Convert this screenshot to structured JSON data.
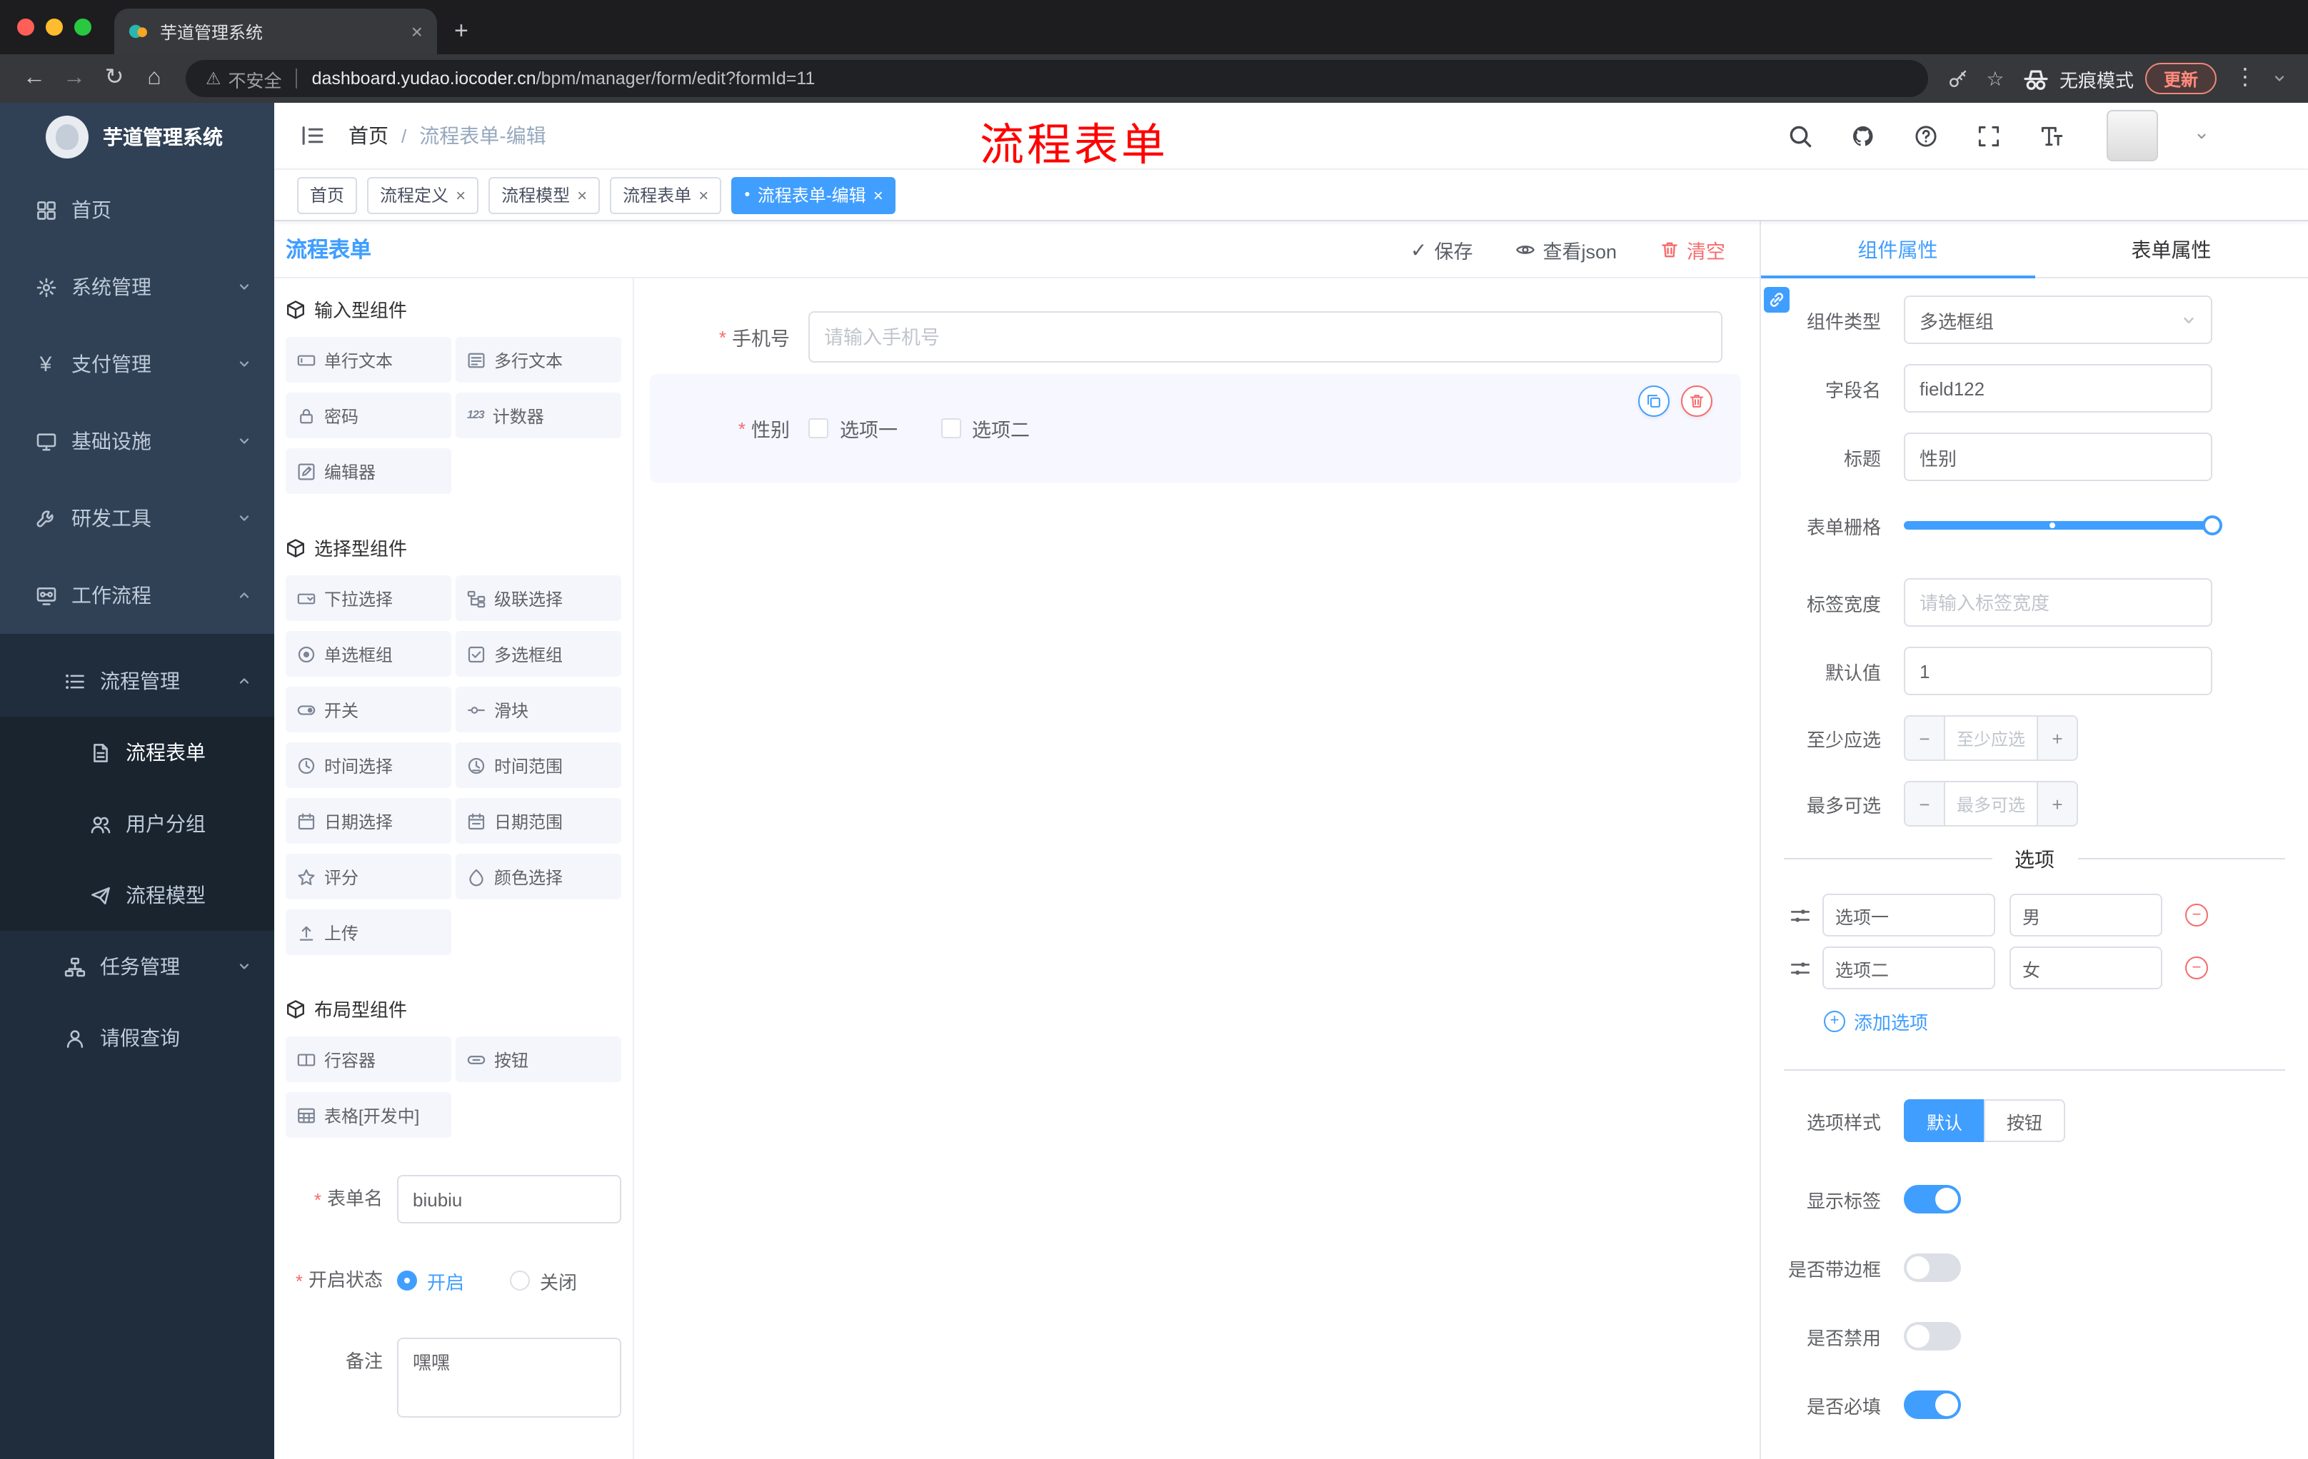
{
  "colors": {
    "accent": "#409eff",
    "danger": "#f56c6c",
    "sidebar_bg": "#304156",
    "annotation": "#ff0000"
  },
  "icons": {
    "favicon": "svg:favicon",
    "close": "×",
    "new-tab": "+",
    "back": "←",
    "forward": "→",
    "reload": "↻",
    "home": "⌂",
    "warning": "⚠",
    "key": "svg:key",
    "star": "☆",
    "incognito": "svg:incognito",
    "overflow-dots": "⋮",
    "chevron-down": "svg:chev",
    "slash": "/",
    "hamburger": "svg:hamburger",
    "search": "svg:search",
    "github": "svg:github",
    "question": "svg:question",
    "fullscreen": "svg:fullscreen",
    "fontsize": "svg:fontsize",
    "dashboard": "svg:dashboard",
    "gear": "svg:gear",
    "yen": "¥",
    "monitor": "svg:monitor",
    "tool": "svg:tool",
    "workflow": "svg:workflow",
    "list": "svg:list",
    "form": "svg:form",
    "users": "svg:users",
    "send": "svg:send",
    "tree": "svg:tree",
    "user": "svg:user",
    "cube": "svg:cube",
    "input": "svg:input",
    "textarea": "svg:textarea",
    "lock": "svg:lock",
    "counter": "123",
    "editor": "svg:editor",
    "select": "svg:select",
    "cascade": "svg:cascade",
    "radio": "svg:radio",
    "checkbox": "svg:checkbox",
    "switch": "svg:switch",
    "slider": "svg:slider",
    "time": "svg:time",
    "timerange": "svg:timerange",
    "date": "svg:date",
    "daterange": "svg:daterange",
    "starline": "svg:star2",
    "color": "svg:color",
    "upload": "svg:upload",
    "row": "svg:row",
    "button": "svg:button",
    "table": "svg:table",
    "check": "✓",
    "eye": "svg:eye",
    "trash": "svg:trash",
    "asterisk": "*",
    "active-dot": "●",
    "copy": "svg:copy",
    "link": "svg:link",
    "drag": "svg:drag",
    "minus": "−",
    "plus": "+"
  },
  "browser": {
    "tab_title": "芋道管理系统",
    "security_label": "不安全",
    "url_host": "dashboard.yudao.iocoder.cn",
    "url_path": "/bpm/manager/form/edit?formId=11",
    "incognito_label": "无痕模式",
    "update_label": "更新"
  },
  "annotation": {
    "text": "流程表单",
    "color": "#ff0000"
  },
  "sidebar": {
    "title": "芋道管理系统",
    "items": [
      {
        "label": "首页",
        "level": 1
      },
      {
        "label": "系统管理",
        "level": 1,
        "expanded": false
      },
      {
        "label": "支付管理",
        "level": 1,
        "expanded": false
      },
      {
        "label": "基础设施",
        "level": 1,
        "expanded": false
      },
      {
        "label": "研发工具",
        "level": 1,
        "expanded": false
      },
      {
        "label": "工作流程",
        "level": 1,
        "expanded": true
      },
      {
        "label": "流程管理",
        "level": 2,
        "expanded": true
      },
      {
        "label": "流程表单",
        "level": 3,
        "active": true
      },
      {
        "label": "用户分组",
        "level": 3
      },
      {
        "label": "流程模型",
        "level": 3
      },
      {
        "label": "任务管理",
        "level": 2,
        "expanded": false
      },
      {
        "label": "请假查询",
        "level": 2
      }
    ]
  },
  "header": {
    "breadcrumb_home": "首页",
    "breadcrumb_current": "流程表单-编辑"
  },
  "page_tabs": [
    {
      "label": "首页",
      "closable": false,
      "active": false
    },
    {
      "label": "流程定义",
      "closable": true,
      "active": false
    },
    {
      "label": "流程模型",
      "closable": true,
      "active": false
    },
    {
      "label": "流程表单",
      "closable": true,
      "active": false
    },
    {
      "label": "流程表单-编辑",
      "closable": true,
      "active": true
    }
  ],
  "designer": {
    "title": "流程表单",
    "actions": {
      "save": "保存",
      "view_json": "查看json",
      "clear": "清空"
    },
    "palette": {
      "sections": [
        {
          "title": "输入型组件",
          "items": [
            "单行文本",
            "多行文本",
            "密码",
            "计数器",
            "编辑器"
          ]
        },
        {
          "title": "选择型组件",
          "items": [
            "下拉选择",
            "级联选择",
            "单选框组",
            "多选框组",
            "开关",
            "滑块",
            "时间选择",
            "时间范围",
            "日期选择",
            "日期范围",
            "评分",
            "颜色选择",
            "上传"
          ]
        },
        {
          "title": "布局型组件",
          "items": [
            "行容器",
            "按钮",
            "表格[开发中]"
          ]
        }
      ]
    },
    "form_meta": {
      "name_label": "表单名",
      "name_value": "biubiu",
      "status_label": "开启状态",
      "status_on": "开启",
      "status_off": "关闭",
      "status_selected": "开启",
      "remark_label": "备注",
      "remark_value": "嘿嘿"
    },
    "canvas": {
      "phone_label": "手机号",
      "phone_placeholder": "请输入手机号",
      "gender_label": "性别",
      "gender_options": [
        "选项一",
        "选项二"
      ]
    }
  },
  "props": {
    "tabs": {
      "component": "组件属性",
      "form": "表单属性"
    },
    "active_tab": "组件属性",
    "component_type_label": "组件类型",
    "component_type_value": "多选框组",
    "field_name_label": "字段名",
    "field_name_value": "field122",
    "title_label": "标题",
    "title_value": "性别",
    "grid_label": "表单栅格",
    "label_width_label": "标签宽度",
    "label_width_placeholder": "请输入标签宽度",
    "default_label": "默认值",
    "default_value": "1",
    "min_label": "至少应选",
    "min_placeholder": "至少应选",
    "max_label": "最多可选",
    "max_placeholder": "最多可选",
    "options_title": "选项",
    "options": [
      {
        "label": "选项一",
        "value": "男"
      },
      {
        "label": "选项二",
        "value": "女"
      }
    ],
    "add_option": "添加选项",
    "style_label": "选项样式",
    "style_default": "默认",
    "style_button": "按钮",
    "style_selected": "默认",
    "switches": [
      {
        "label": "显示标签",
        "on": true
      },
      {
        "label": "是否带边框",
        "on": false
      },
      {
        "label": "是否禁用",
        "on": false
      },
      {
        "label": "是否必填",
        "on": true
      }
    ]
  }
}
